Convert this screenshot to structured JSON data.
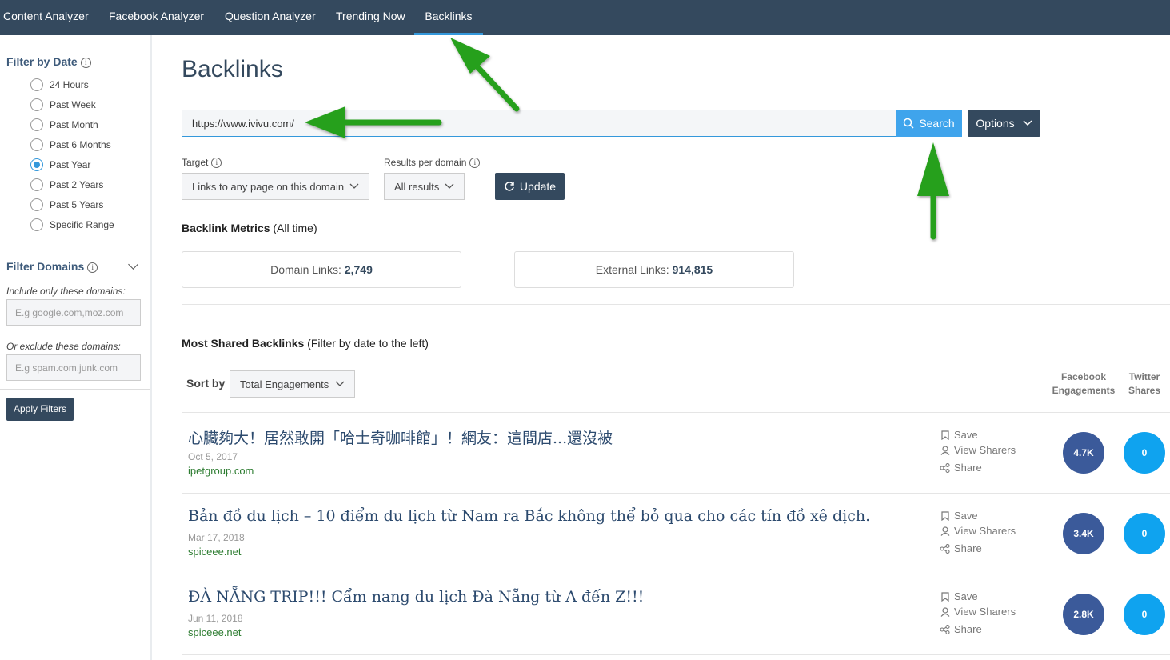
{
  "nav": {
    "items": [
      {
        "label": "Content Analyzer"
      },
      {
        "label": "Facebook Analyzer"
      },
      {
        "label": "Question Analyzer"
      },
      {
        "label": "Trending Now"
      },
      {
        "label": "Backlinks"
      }
    ],
    "active": "Backlinks"
  },
  "sidebar": {
    "filter_date": {
      "title": "Filter by Date",
      "options": [
        "24 Hours",
        "Past Week",
        "Past Month",
        "Past 6 Months",
        "Past Year",
        "Past 2 Years",
        "Past 5 Years",
        "Specific Range"
      ],
      "selected": "Past Year"
    },
    "filter_domains": {
      "title": "Filter Domains",
      "include_label": "Include only these domains:",
      "include_placeholder": "E.g google.com,moz.com",
      "exclude_label": "Or exclude these domains:",
      "exclude_placeholder": "E.g spam.com,junk.com",
      "apply_label": "Apply Filters"
    }
  },
  "main": {
    "title": "Backlinks",
    "search": {
      "value": "https://www.ivivu.com/",
      "button_label": "Search"
    },
    "options_label": "Options",
    "target": {
      "label": "Target",
      "value": "Links to any page on this domain"
    },
    "results_per_domain": {
      "label": "Results per domain",
      "value": "All results"
    },
    "update_label": "Update",
    "metrics": {
      "heading": "Backlink Metrics",
      "heading_note": "(All time)",
      "domain_links_label": "Domain Links:",
      "domain_links_value": "2,749",
      "external_links_label": "External Links:",
      "external_links_value": "914,815"
    },
    "most_shared": {
      "heading": "Most Shared Backlinks",
      "note": "(Filter by date to the left)",
      "sort_label": "Sort by",
      "sort_value": "Total Engagements",
      "col_facebook": "Facebook Engagements",
      "col_twitter": "Twitter Shares",
      "actions": {
        "save": "Save",
        "view_sharers": "View Sharers",
        "share": "Share"
      },
      "rows": [
        {
          "title": "心臟夠大！居然敢開「哈士奇咖啡館」！網友：這間店...還沒被",
          "date": "Oct 5, 2017",
          "domain": "ipetgroup.com",
          "facebook": "4.7K",
          "twitter": "0"
        },
        {
          "title": "Bản đồ du lịch – 10 điểm du lịch từ Nam ra Bắc không thể bỏ qua cho các tín đồ xê dịch.",
          "date": "Mar 17, 2018",
          "domain": "spiceee.net",
          "facebook": "3.4K",
          "twitter": "0"
        },
        {
          "title": "ĐÀ NẴNG TRIP!!! Cẩm nang du lịch Đà Nẵng từ A đến Z!!!",
          "date": "Jun 11, 2018",
          "domain": "spiceee.net",
          "facebook": "2.8K",
          "twitter": "0"
        }
      ]
    }
  },
  "colors": {
    "nav_bg": "#34495e",
    "accent_blue": "#3fa4ec",
    "facebook_circle": "#3b5a9a",
    "twitter_circle": "#0fa3ef",
    "annotation_arrow": "#27a01a"
  },
  "icons": [
    "info-icon",
    "search-icon",
    "caret-down-icon",
    "refresh-icon",
    "bookmark-icon",
    "user-icon",
    "share-icon",
    "annotation-arrow"
  ]
}
